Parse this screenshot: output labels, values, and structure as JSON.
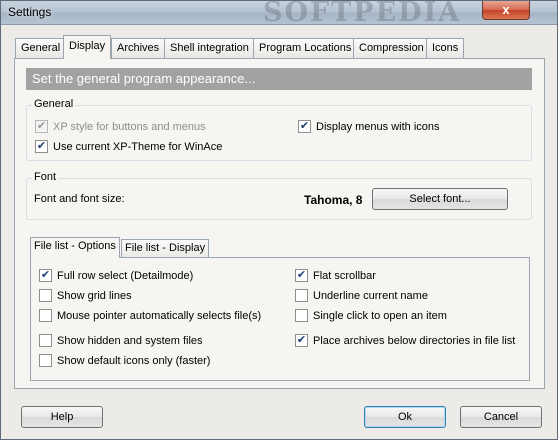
{
  "window": {
    "title": "Settings",
    "watermark": "SOFTPEDIA",
    "close_glyph": "x"
  },
  "tabs": [
    "General",
    "Display",
    "Archives",
    "Shell integration",
    "Program Locations",
    "Compression",
    "Icons"
  ],
  "active_tab": "Display",
  "banner": "Set the general program appearance...",
  "general": {
    "label": "General",
    "xp_style": "XP style for buttons and menus",
    "xp_style_checked": true,
    "xp_style_enabled": false,
    "use_theme": "Use current XP-Theme for WinAce",
    "use_theme_checked": true,
    "menus_icons": "Display menus with icons",
    "menus_icons_checked": true
  },
  "font": {
    "label": "Font",
    "caption": "Font and font size:",
    "value": "Tahoma, 8",
    "select_button": "Select font..."
  },
  "file_list_tabs": [
    "File list - Options",
    "File list - Display"
  ],
  "file_list_options": {
    "full_row": {
      "label": "Full row select (Detailmode)",
      "checked": true
    },
    "grid_lines": {
      "label": "Show grid lines",
      "checked": false
    },
    "mouse_pointer": {
      "label": "Mouse pointer automatically selects file(s)",
      "checked": false
    },
    "hidden_files": {
      "label": "Show hidden and system files",
      "checked": false
    },
    "default_icons": {
      "label": "Show default icons only (faster)",
      "checked": false
    },
    "flat_scrollbar": {
      "label": "Flat scrollbar",
      "checked": true
    },
    "underline": {
      "label": "Underline current name",
      "checked": false
    },
    "single_click": {
      "label": "Single click to open an item",
      "checked": false
    },
    "archives_below": {
      "label": "Place archives below directories in file list",
      "checked": true
    }
  },
  "buttons": {
    "help": "Help",
    "ok": "Ok",
    "cancel": "Cancel"
  }
}
